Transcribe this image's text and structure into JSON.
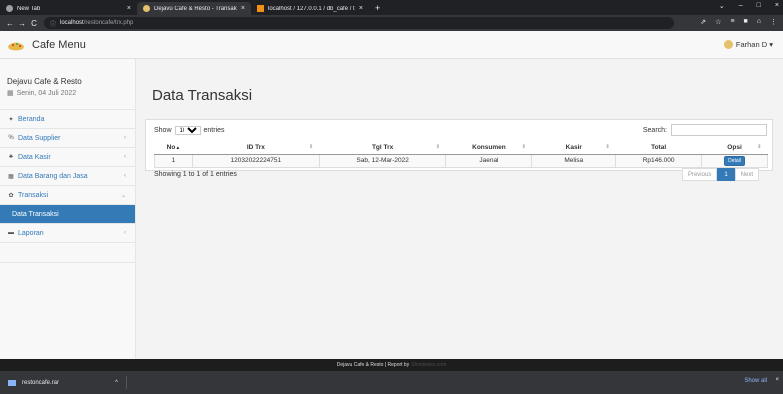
{
  "browser": {
    "tabs": [
      {
        "label": "New Tab",
        "close": "×"
      },
      {
        "label": "Dejavu Cafe & Resto - Transaksi",
        "close": "×"
      },
      {
        "label": "localhost / 127.0.0.1 / db_cafe / t",
        "close": "×"
      }
    ],
    "new_tab": "+",
    "window_controls": [
      "⌄",
      "–",
      "□",
      "×"
    ],
    "nav": {
      "back": "←",
      "forward": "→",
      "reload": "C"
    },
    "url_host": "localhost",
    "url_path": "/restoncafe/trx.php",
    "toolbar_icons": [
      "⇗",
      "☆",
      "≡",
      "■",
      "⌂",
      "⋮"
    ]
  },
  "header": {
    "app_title": "Cafe Menu",
    "user_name": "Farhan D ▾"
  },
  "sidebar": {
    "app_name": "Dejavu Cafe & Resto",
    "date": "Senin, 04 Juli 2022",
    "date_icon": "▦",
    "items": [
      {
        "icon": "✦",
        "label": "Beranda",
        "arrow": ""
      },
      {
        "icon": "%",
        "label": "Data Supplier",
        "arrow": "‹"
      },
      {
        "icon": "♣",
        "label": "Data Kasir",
        "arrow": "‹"
      },
      {
        "icon": "▦",
        "label": "Data Barang dan Jasa",
        "arrow": "‹"
      },
      {
        "icon": "✿",
        "label": "Transaksi",
        "arrow": "⌄"
      }
    ],
    "subitem": "Data Transaksi",
    "last_item": {
      "icon": "▬",
      "label": "Laporan",
      "arrow": "‹"
    }
  },
  "main": {
    "page_title": "Data Transaksi",
    "show_label": "Show",
    "entries_value": "10",
    "entries_label": "entries",
    "search_label": "Search:",
    "columns": [
      "No",
      "ID Trx",
      "Tgl Trx",
      "Konsumen",
      "Kasir",
      "Total",
      "Opsi"
    ],
    "sort_first": "▲",
    "sort_both": "⇕",
    "rows": [
      {
        "no": "1",
        "id": "12032022224751",
        "tgl": "Sab, 12-Mar-2022",
        "konsumen": "Jaenal",
        "kasir": "Melisa",
        "total": "Rp146.000",
        "action": "Detail"
      }
    ],
    "info": "Showing 1 to 1 of 1 entries",
    "pager": {
      "prev": "Previous",
      "current": "1",
      "next": "Next"
    }
  },
  "footer": {
    "text": "Dejavu Cafe & Resto | Report by ",
    "link": "Shindeviss.com"
  },
  "download_shelf": {
    "file": "restoncafe.rar",
    "caret": "^",
    "show_all": "Show all",
    "close": "×"
  }
}
